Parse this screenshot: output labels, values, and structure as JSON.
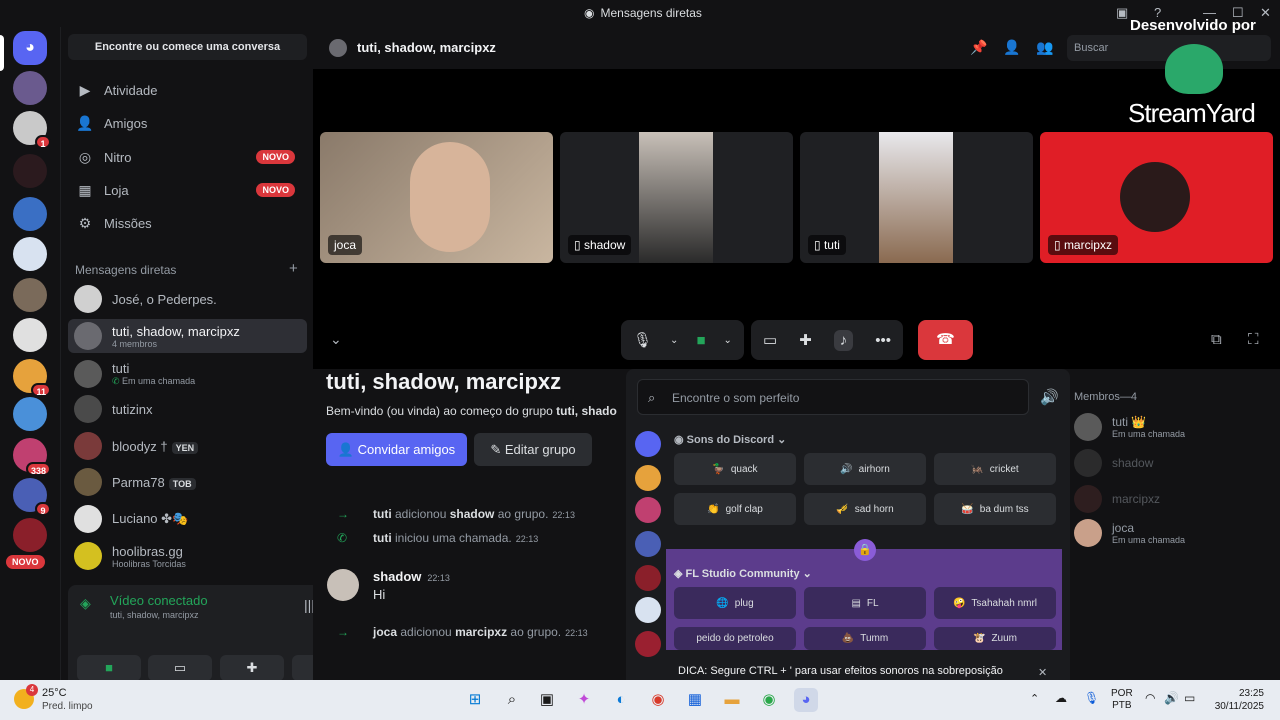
{
  "window": {
    "title": "Mensagens diretas"
  },
  "rail": {
    "badges": [
      "1",
      "11",
      "338",
      "9"
    ],
    "novo": "NOVO"
  },
  "sidebar": {
    "find_label": "Encontre ou comece uma conversa",
    "nav": [
      {
        "label": "Atividade",
        "icon": "activity-icon"
      },
      {
        "label": "Amigos",
        "icon": "friends-icon"
      },
      {
        "label": "Nitro",
        "icon": "nitro-icon",
        "badge": "NOVO"
      },
      {
        "label": "Loja",
        "icon": "shop-icon",
        "badge": "NOVO"
      },
      {
        "label": "Missões",
        "icon": "quests-icon"
      }
    ],
    "dm_header": "Mensagens diretas",
    "dms": [
      {
        "name": "José, o Pederpes.",
        "sub": ""
      },
      {
        "name": "tuti, shadow, marcipxz",
        "sub": "4 membros"
      },
      {
        "name": "tuti",
        "sub": "Em uma chamada"
      },
      {
        "name": "tutizinx",
        "sub": ""
      },
      {
        "name": "bloodyz †",
        "sub": "",
        "tag": "YEN"
      },
      {
        "name": "Parma78",
        "sub": "",
        "tag": "TOB"
      },
      {
        "name": "Luciano ✤🎭",
        "sub": ""
      },
      {
        "name": "hoolibras.gg",
        "sub": "Hoolibras Torcidas"
      }
    ],
    "voice": {
      "title": "Vídeo conectado",
      "sub": "tuti, shadow, marcipxz"
    }
  },
  "header": {
    "title": "tuti, shadow, marcipxz",
    "search_placeholder": "Buscar"
  },
  "stage": {
    "tiles": [
      {
        "label": "joca"
      },
      {
        "label": "shadow"
      },
      {
        "label": "tuti"
      },
      {
        "label": "marcipxz"
      }
    ]
  },
  "chat": {
    "title": "tuti, shadow, marcipxz",
    "welcome_prefix": "Bem-vindo (ou vinda) ao começo do grupo ",
    "welcome_group": "tuti, shado",
    "invite": "Convidar amigos",
    "edit": "Editar grupo",
    "events": [
      {
        "actor": "tuti",
        "text": " adicionou ",
        "target": "shadow",
        "suffix": " ao grupo.",
        "time": "22:13"
      },
      {
        "actor": "tuti",
        "text": " iniciou uma chamada.",
        "target": "",
        "suffix": "",
        "time": "22:13"
      }
    ],
    "message": {
      "author": "shadow",
      "time": "22:13",
      "text": "Hi"
    },
    "event3": {
      "actor": "joca",
      "text": " adicionou ",
      "target": "marcipxz",
      "suffix": " ao grupo.",
      "time": "22:13"
    }
  },
  "soundboard": {
    "search_placeholder": "Encontre o som perfeito",
    "cat1": "Sons do Discord",
    "sounds1": [
      "quack",
      "airhorn",
      "cricket",
      "golf clap",
      "sad horn",
      "ba dum tss"
    ],
    "cat2": "FL Studio Community",
    "sounds2": [
      "plug",
      "FL",
      "Tsahahah nmrl",
      "peido do petroleo",
      "Tumm",
      "Zuum"
    ],
    "tip": "DICA: Segure CTRL + ' para usar efeitos sonoros na sobreposição"
  },
  "members": {
    "header": "Membros—4",
    "list": [
      {
        "name": "tuti 👑",
        "sub": "Em uma chamada"
      },
      {
        "name": "shadow",
        "sub": ""
      },
      {
        "name": "marcipxz",
        "sub": ""
      },
      {
        "name": "joca",
        "sub": "Em uma chamada"
      }
    ]
  },
  "watermark": {
    "line1": "Desenvolvido por",
    "brand": "StreamYard"
  },
  "taskbar": {
    "temp": "25°C",
    "weather": "Pred. limpo",
    "lang1": "POR",
    "lang2": "PTB",
    "time": "23:25",
    "date": "30/11/2025",
    "weather_badge": "4"
  },
  "colors": {
    "blurple": "#5865f2",
    "green": "#23a55a",
    "red": "#da373c",
    "soundboard_purple": "#5c3c8c"
  }
}
